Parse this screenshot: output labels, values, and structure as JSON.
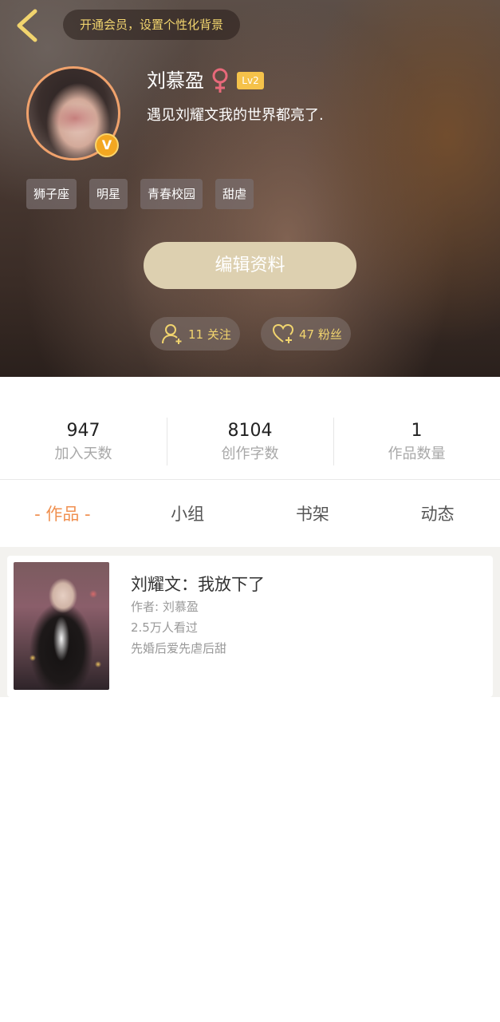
{
  "header": {
    "vip_banner": "开通会员，设置个性化背景",
    "username": "刘慕盈",
    "level": "Lv2",
    "verified_mark": "V",
    "signature": "遇见刘耀文我的世界都亮了.",
    "tags": [
      "狮子座",
      "明星",
      "青春校园",
      "甜虐"
    ],
    "edit_label": "编辑资料",
    "follow_label": "11 关注",
    "fans_label": "47 粉丝"
  },
  "stats": [
    {
      "value": "947",
      "label": "加入天数"
    },
    {
      "value": "8104",
      "label": "创作字数"
    },
    {
      "value": "1",
      "label": "作品数量"
    }
  ],
  "tabs": [
    "- 作品 -",
    "小组",
    "书架",
    "动态"
  ],
  "works": [
    {
      "title": "刘耀文：我放下了",
      "author": "作者: 刘慕盈",
      "views": "2.5万人看过",
      "desc": "先婚后爱先虐后甜"
    }
  ],
  "colors": {
    "accent": "#f09050",
    "vip_text": "#f1d46e",
    "edit_button": "#ddd0b0",
    "level_badge": "#f5c24a",
    "gender": "#e8697a"
  },
  "icons": [
    "chevron-left-icon",
    "female-icon",
    "add-user-icon",
    "heart-plus-icon"
  ]
}
